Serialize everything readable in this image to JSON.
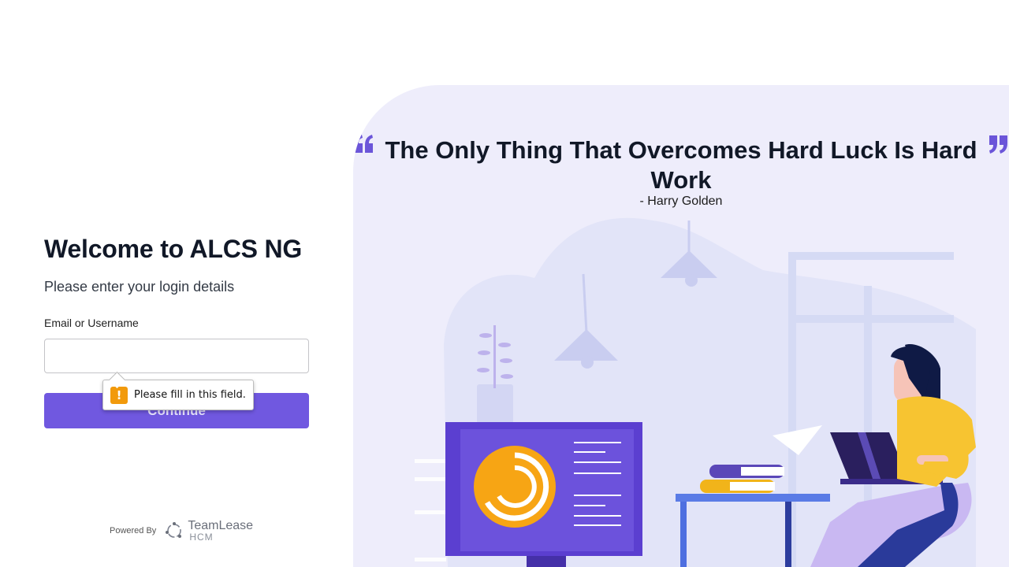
{
  "login": {
    "title": "Welcome to ALCS NG",
    "subtitle": "Please enter your login details",
    "email_label": "Email or Username",
    "email_value": "",
    "email_placeholder": "",
    "continue_label": "Continue"
  },
  "validation": {
    "message": "Please fill in this field.",
    "icon": "warning-icon"
  },
  "footer": {
    "powered_by": "Powered By",
    "brand_name": "TeamLease",
    "brand_sub": "HCM"
  },
  "quote": {
    "text": "The Only Thing That Overcomes Hard Luck Is Hard Work",
    "author": "- Harry Golden"
  },
  "colors": {
    "primary": "#7058e0",
    "panel_bg": "#eeedfb",
    "quote_mark": "#6b55d9",
    "warning": "#f29a0c"
  }
}
